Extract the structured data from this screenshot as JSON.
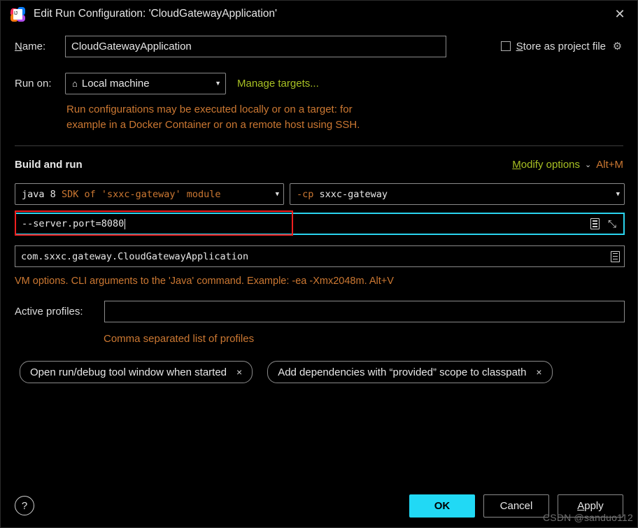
{
  "window": {
    "title": "Edit Run Configuration: 'CloudGatewayApplication'",
    "logo_icon": "intellij-idea-logo",
    "close_icon": "✕"
  },
  "name_field": {
    "label_prefix": "N",
    "label_rest": "ame:",
    "value": "CloudGatewayApplication"
  },
  "store_as_project_file": {
    "label_prefix": "S",
    "label_rest": "tore as project file",
    "checked": false,
    "gear_icon": "⚙"
  },
  "run_on": {
    "label": "Run on:",
    "home_icon": "⌂",
    "value": "Local machine",
    "caret_icon": "▼",
    "manage_targets_link": "Manage targets..."
  },
  "hint": {
    "line1": "Run configurations may be executed locally or on a target: for",
    "line2": "example in a Docker Container or on a remote host using SSH."
  },
  "build_and_run": {
    "title": "Build and run",
    "modify_options_prefix": "M",
    "modify_options_rest": "odify options",
    "modify_caret_icon": "⌄",
    "shortcut": "Alt+M"
  },
  "sdk_combo": {
    "text_white_1": "java",
    "text_white_2": "8",
    "text_orange": "SDK of 'sxxc-gateway' module",
    "caret_icon": "▼"
  },
  "classpath_combo": {
    "text_orange": "-cp",
    "text_white": "sxxc-gateway",
    "caret_icon": "▼"
  },
  "program_arguments": {
    "value": "--server.port=8080",
    "expand_icon": "⤡",
    "doc_icon": "list-document-icon",
    "focused": true,
    "annotation_color": "#f01f1f",
    "focus_color": "#2ad4ef"
  },
  "main_class": {
    "value": "com.sxxc.gateway.CloudGatewayApplication",
    "doc_icon": "list-document-icon"
  },
  "vm_options_hint": "VM options. CLI arguments to the 'Java' command. Example: -ea -Xmx2048m. Alt+V",
  "active_profiles": {
    "label": "Active profiles:",
    "value": "",
    "hint": "Comma separated list of profiles"
  },
  "chips": [
    {
      "label": "Open run/debug tool window when started",
      "close_icon": "×"
    },
    {
      "label": "Add dependencies with “provided” scope to classpath",
      "close_icon": "×"
    }
  ],
  "footer": {
    "help_icon": "?",
    "ok_label": "OK",
    "cancel_label": "Cancel",
    "apply_prefix": "A",
    "apply_rest": "pply",
    "ok_color": "#21d9f5"
  },
  "watermark": "CSDN @sanduo112"
}
